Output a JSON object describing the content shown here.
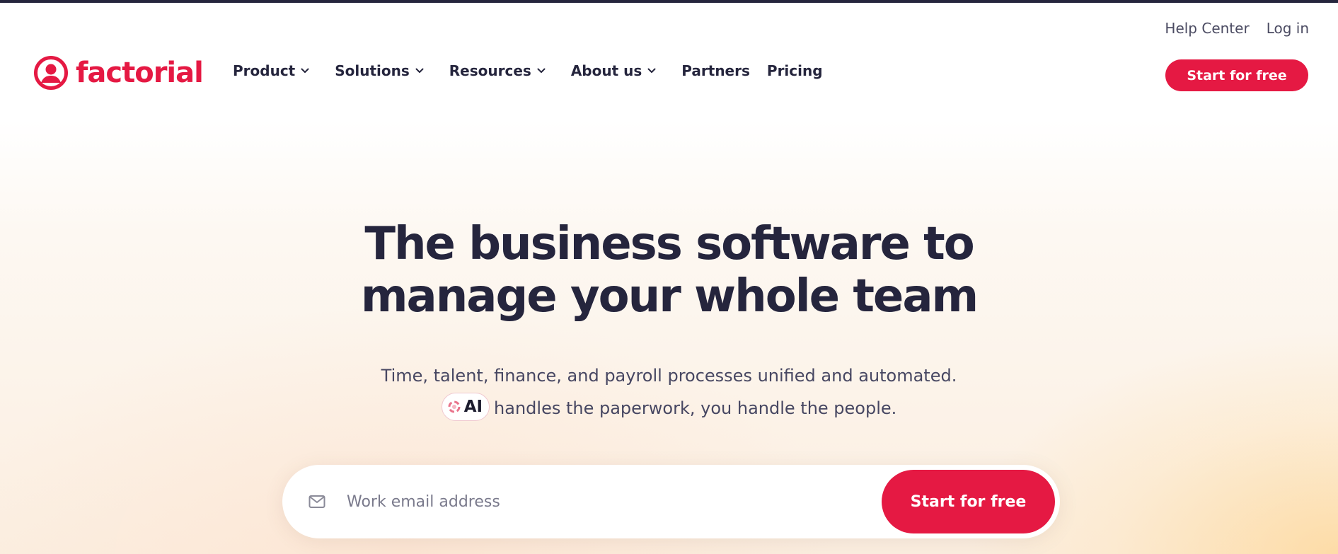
{
  "colors": {
    "brand": "#e51943",
    "text_dark": "#25253d",
    "top_strip": "#25253d"
  },
  "utility_nav": {
    "help_center": "Help Center",
    "log_in": "Log in"
  },
  "logo": {
    "icon": "factorial-person-circle-icon",
    "text": "factorial"
  },
  "nav": {
    "items": [
      {
        "label": "Product",
        "icon": "chevron-down-icon"
      },
      {
        "label": "Solutions",
        "icon": "chevron-down-icon"
      },
      {
        "label": "Resources",
        "icon": "chevron-down-icon"
      },
      {
        "label": "About us",
        "icon": "chevron-down-icon"
      },
      {
        "label": "Partners"
      },
      {
        "label": "Pricing"
      }
    ],
    "cta_label": "Start for free"
  },
  "hero": {
    "title_line1": "The business software to",
    "title_line2": "manage your whole team",
    "subtitle_line1": "Time, talent, finance, and payroll processes unified and automated.",
    "ai_badge": {
      "icon": "factorial-ai-icon",
      "label": "AI"
    },
    "subtitle_line2": "handles the paperwork, you handle the people."
  },
  "signup": {
    "icon": "mail-icon",
    "placeholder": "Work email address",
    "value": "",
    "button_label": "Start for free"
  }
}
